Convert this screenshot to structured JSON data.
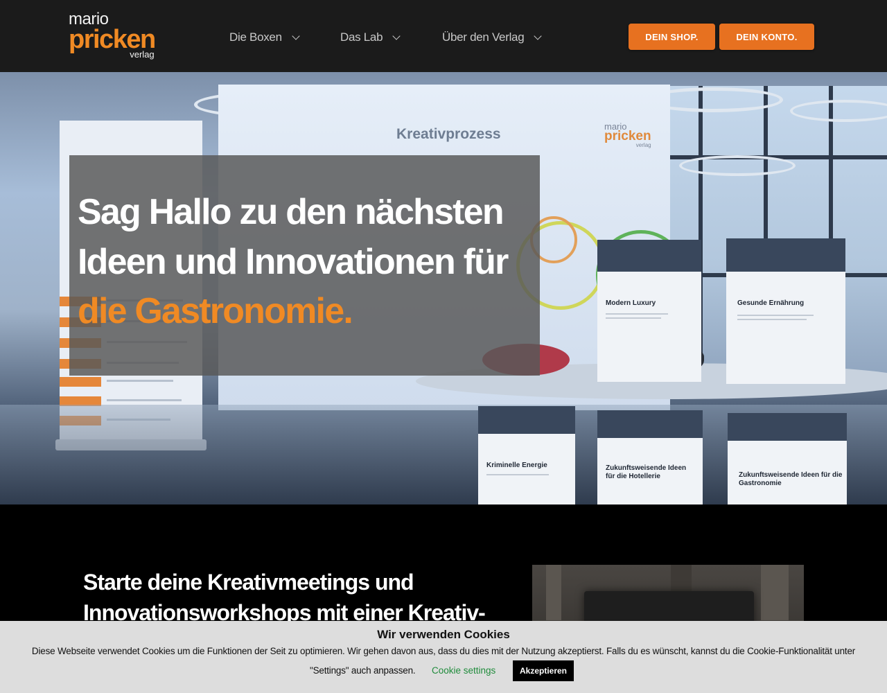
{
  "header": {
    "logo": {
      "line1": "mario",
      "line2": "pricken",
      "line3": "verlag"
    },
    "nav": [
      {
        "label": "Die Boxen"
      },
      {
        "label": "Das Lab"
      },
      {
        "label": "Über den Verlag"
      }
    ],
    "buttons": {
      "shop": "DEIN SHOP.",
      "account": "DEIN KONTO."
    }
  },
  "hero": {
    "headline_line1": "Sag Hallo zu den nächsten",
    "headline_line2": "Ideen und Innovationen für",
    "headline_highlight": "die Gastronomie.",
    "scene": {
      "board_title": "Kreativprozess",
      "board_logo": {
        "line1": "mario",
        "line2": "pricken",
        "line3": "verlag"
      },
      "boxes": [
        "Modern Luxury",
        "Gesunde Ernährung",
        "Kriminelle Energie",
        "Zukunftsweisende Ideen für die Hotellerie",
        "Zukunftsweisende Ideen für die Gastronomie"
      ]
    }
  },
  "intro": {
    "line1": "Starte deine Kreativmeetings und",
    "line2": "Innovationsworkshops mit einer Kreativ-"
  },
  "cookie_banner": {
    "title": "Wir verwenden Cookies",
    "text_line1": "Diese Webseite verwendet Cookies um die Funktionen der Seit zu optimieren. Wir gehen davon aus, dass du dies mit der Nutzung akzeptierst. Falls du es wünscht, kannst du die Cookie-Funktionalität unter",
    "text_line2": "\"Settings\" auch anpassen.",
    "settings_link": "Cookie settings",
    "accept_button": "Akzeptieren"
  },
  "colors": {
    "accent": "#e77120",
    "highlight": "#f08a24",
    "header_bg": "#1b1b1b",
    "link_green": "#1f8b3b"
  }
}
